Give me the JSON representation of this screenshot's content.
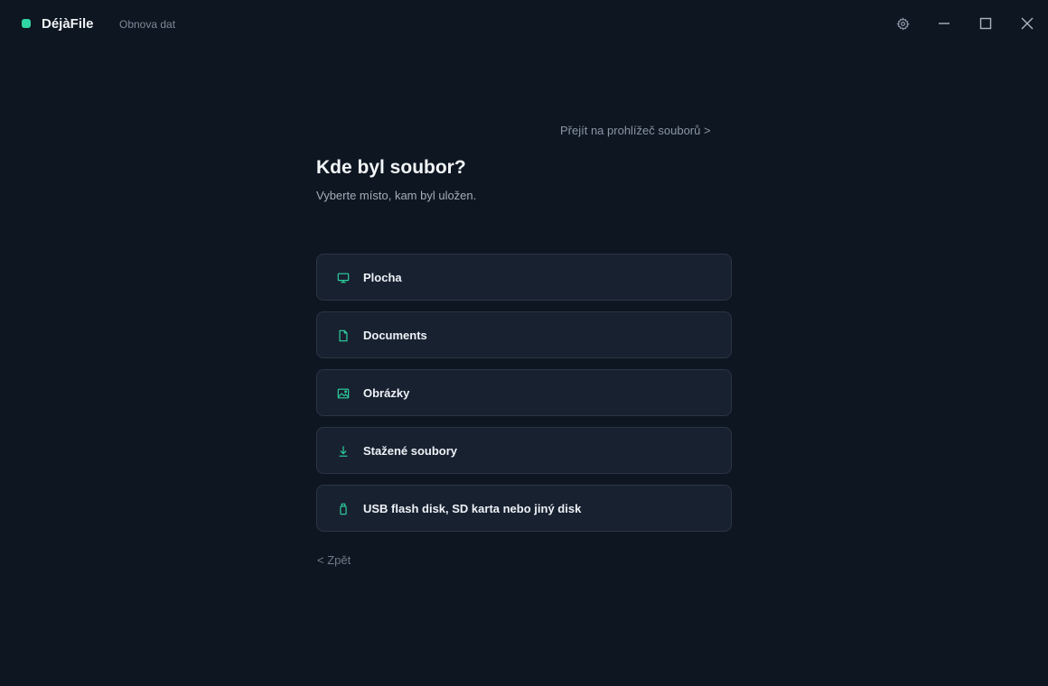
{
  "app": {
    "name": "DéjàFile",
    "subtitle": "Obnova dat",
    "accent_color": "#2fd6a3"
  },
  "window_controls": {
    "settings_icon": "gear-icon",
    "minimize_icon": "minimize-icon",
    "maximize_icon": "maximize-icon",
    "close_icon": "close-icon"
  },
  "main": {
    "browser_link": "Přejít na prohlížeč souborů >",
    "title": "Kde byl soubor?",
    "subtitle": "Vyberte místo, kam byl uložen.",
    "options": [
      {
        "label": "Plocha",
        "icon": "monitor-icon"
      },
      {
        "label": "Documents",
        "icon": "document-icon"
      },
      {
        "label": "Obrázky",
        "icon": "image-icon"
      },
      {
        "label": "Stažené soubory",
        "icon": "download-icon"
      },
      {
        "label": "USB flash disk, SD karta nebo jiný disk",
        "icon": "usb-drive-icon"
      }
    ],
    "back_link": "< Zpět"
  }
}
